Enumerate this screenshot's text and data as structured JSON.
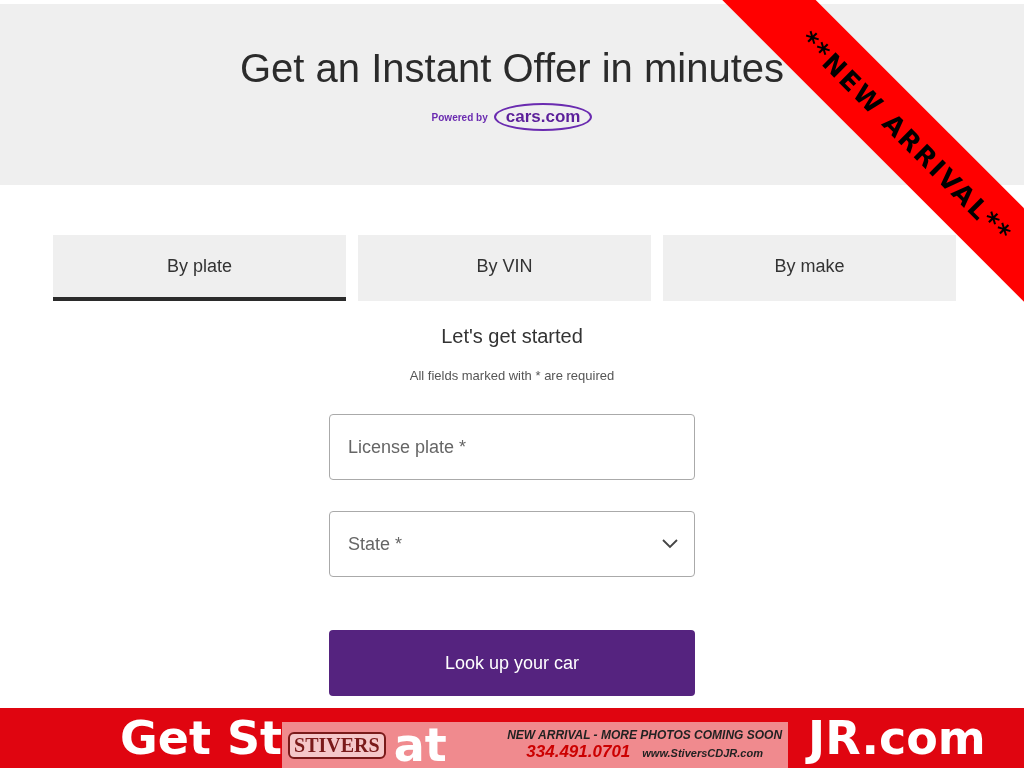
{
  "header": {
    "title": "Get an Instant Offer in minutes",
    "powered_by": "Powered by",
    "brand": "cars.com"
  },
  "tabs": [
    {
      "label": "By plate",
      "selected": true
    },
    {
      "label": "By VIN",
      "selected": false
    },
    {
      "label": "By make",
      "selected": false
    }
  ],
  "form": {
    "heading": "Let's get started",
    "note": "All fields marked with * are required",
    "fields": [
      {
        "kind": "text",
        "placeholder": "License plate *"
      },
      {
        "kind": "select",
        "placeholder": "State *"
      }
    ],
    "submit": "Look up your car"
  },
  "ribbon": {
    "text": "**NEW ARRIVAL**"
  },
  "footer_bar": {
    "lead": "Get St",
    "middle": "at",
    "tail": "JR.com",
    "logo": "STIVERS",
    "notice": "NEW ARRIVAL - MORE PHOTOS COMING SOON",
    "phone": "334.491.0701",
    "website": "www.StiversCDJR.com"
  }
}
